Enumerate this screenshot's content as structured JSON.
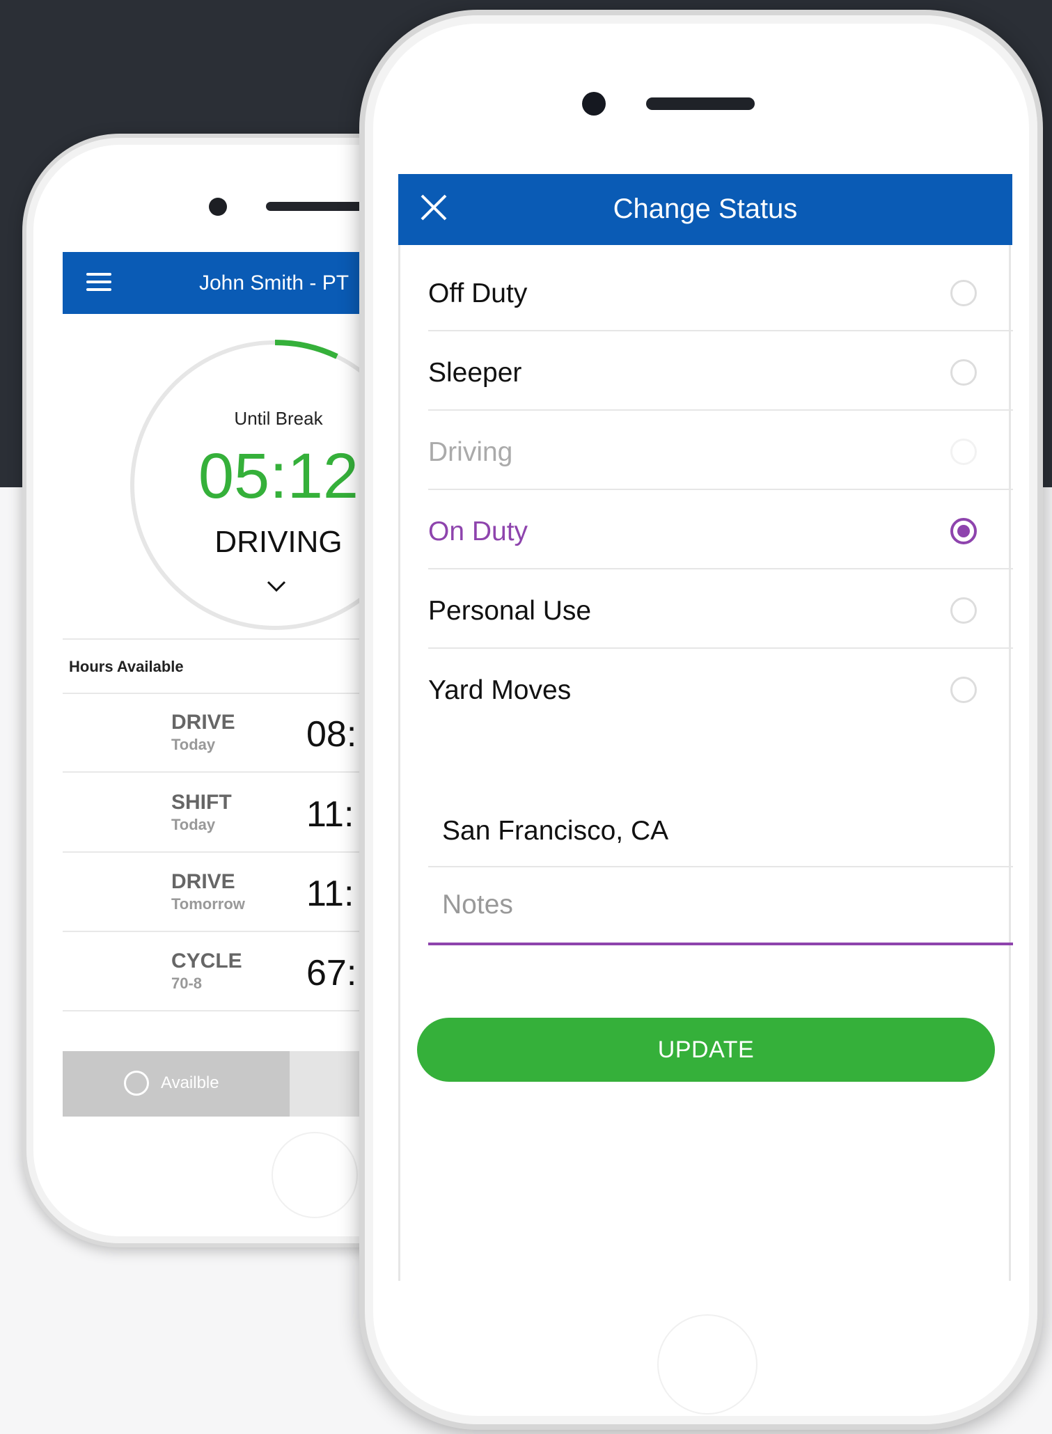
{
  "back_phone": {
    "header_title": "John Smith - PT",
    "timer": {
      "label": "Until Break",
      "time": "05:12",
      "status": "DRIVING"
    },
    "hours_available_title": "Hours Available",
    "rows": [
      {
        "label": "DRIVE",
        "sub": "Today",
        "value": "08:"
      },
      {
        "label": "SHIFT",
        "sub": "Today",
        "value": "11:"
      },
      {
        "label": "DRIVE",
        "sub": "Tomorrow",
        "value": "11:"
      },
      {
        "label": "CYCLE",
        "sub": "70-8",
        "value": "67:"
      }
    ],
    "available_button": "Availble"
  },
  "front_phone": {
    "header_title": "Change Status",
    "statuses": [
      {
        "label": "Off Duty",
        "state": "normal"
      },
      {
        "label": "Sleeper",
        "state": "normal"
      },
      {
        "label": "Driving",
        "state": "disabled"
      },
      {
        "label": "On Duty",
        "state": "selected"
      },
      {
        "label": "Personal Use",
        "state": "normal"
      },
      {
        "label": "Yard Moves",
        "state": "normal"
      }
    ],
    "location": "San Francisco, CA",
    "notes_placeholder": "Notes",
    "update_button": "UPDATE"
  },
  "colors": {
    "brand_blue": "#0a5bb5",
    "accent_green": "#35b03a",
    "selected_purple": "#8e44ad",
    "dark_background": "#2b2f36"
  },
  "icons": {
    "menu": "hamburger-icon",
    "close": "close-icon",
    "chevron": "chevron-down-icon",
    "clock": "clock-icon"
  }
}
